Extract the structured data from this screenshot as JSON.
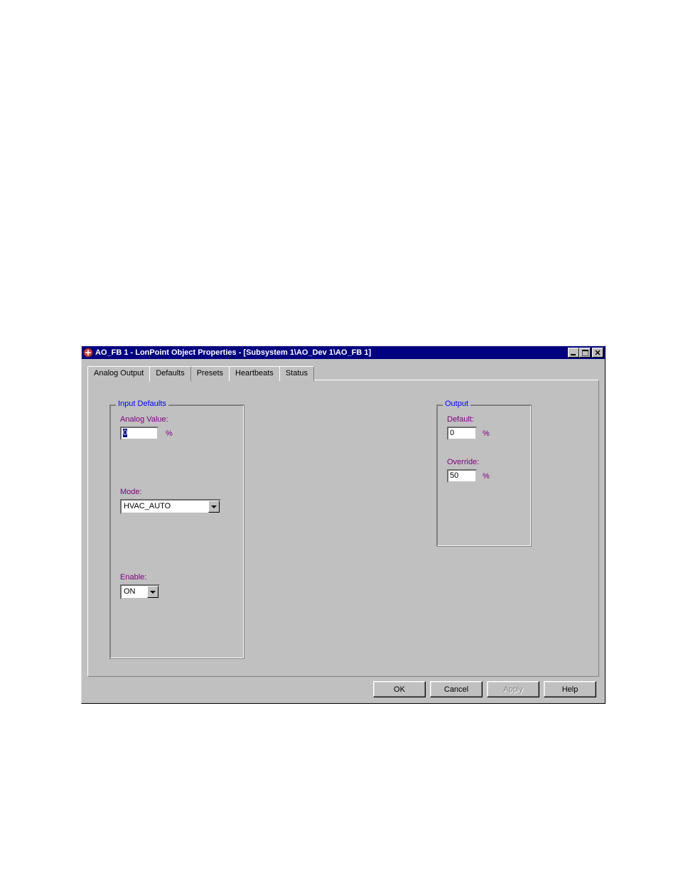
{
  "window": {
    "title": "AO_FB 1 - LonPoint Object Properties - [Subsystem 1\\AO_Dev 1\\AO_FB 1]"
  },
  "tabs": [
    {
      "label": "Analog Output",
      "active": false
    },
    {
      "label": "Defaults",
      "active": true
    },
    {
      "label": "Presets",
      "active": false
    },
    {
      "label": "Heartbeats",
      "active": false
    },
    {
      "label": "Status",
      "active": false
    }
  ],
  "input_defaults": {
    "legend": "Input Defaults",
    "analog_value_label": "Analog Value:",
    "analog_value": "0",
    "analog_value_unit": "%",
    "mode_label": "Mode:",
    "mode_value": "HVAC_AUTO",
    "enable_label": "Enable:",
    "enable_value": "ON"
  },
  "output": {
    "legend": "Output",
    "default_label": "Default:",
    "default_value": "0",
    "default_unit": "%",
    "override_label": "Override:",
    "override_value": "50",
    "override_unit": "%"
  },
  "buttons": {
    "ok": "OK",
    "cancel": "Cancel",
    "apply": "Apply",
    "help": "Help"
  }
}
